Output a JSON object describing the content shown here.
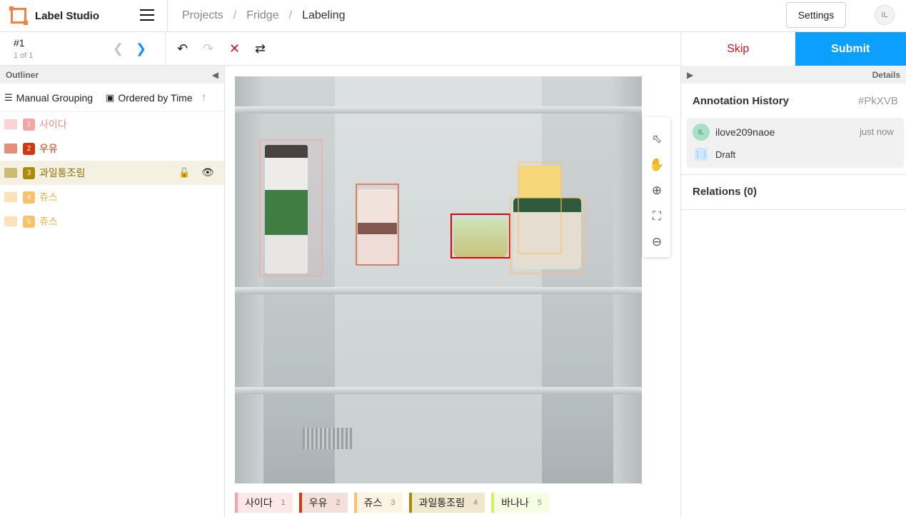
{
  "app": {
    "name": "Label Studio"
  },
  "breadcrumb": [
    "Projects",
    "Fridge",
    "Labeling"
  ],
  "header": {
    "settings_label": "Settings",
    "user_initials": "IL"
  },
  "task": {
    "id": "#1",
    "count": "1 of 1"
  },
  "actions": {
    "skip": "Skip",
    "submit": "Submit"
  },
  "outliner": {
    "title": "Outliner",
    "grouping": "Manual Grouping",
    "ordering": "Ordered by Time",
    "regions": [
      {
        "num": "1",
        "label": "사이다",
        "color": "#f7a3a3",
        "text_color": "#f08e8e"
      },
      {
        "num": "2",
        "label": "우유",
        "color": "#d4380d",
        "text_color": "#c23a0d"
      },
      {
        "num": "3",
        "label": "과일통조림",
        "color": "#ad8b00",
        "text_color": "#8c6f00"
      },
      {
        "num": "4",
        "label": "쥬스",
        "color": "#ffc069",
        "text_color": "#f0a93e"
      },
      {
        "num": "5",
        "label": "쥬스",
        "color": "#ffc069",
        "text_color": "#f0a93e"
      }
    ]
  },
  "labels": [
    {
      "name": "사이다",
      "hotkey": "1",
      "color": "#f7a3a3",
      "bg": "#fde8e8"
    },
    {
      "name": "우유",
      "hotkey": "2",
      "color": "#d4380d",
      "bg": "#f5e0d9"
    },
    {
      "name": "쥬스",
      "hotkey": "3",
      "color": "#ffc069",
      "bg": "#fff4e3"
    },
    {
      "name": "과일통조림",
      "hotkey": "4",
      "color": "#ad8b00",
      "bg": "#efe8cf"
    },
    {
      "name": "바나나",
      "hotkey": "5",
      "color": "#d3f261",
      "bg": "#f6fde3"
    }
  ],
  "right_panel": {
    "details_label": "Details",
    "history_title": "Annotation History",
    "history_id": "#PkXVB",
    "entry": {
      "initials": "IL",
      "user": "ilove209naoe",
      "time": "just now",
      "status": "Draft"
    },
    "relations": "Relations (0)"
  }
}
